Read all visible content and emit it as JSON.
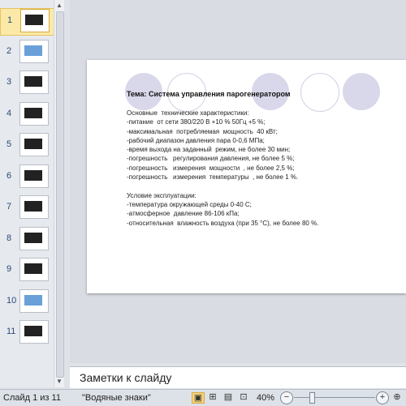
{
  "slides_panel": {
    "thumbnails": [
      {
        "num": "1"
      },
      {
        "num": "2"
      },
      {
        "num": "3"
      },
      {
        "num": "4"
      },
      {
        "num": "5"
      },
      {
        "num": "6"
      },
      {
        "num": "7"
      },
      {
        "num": "8"
      },
      {
        "num": "9"
      },
      {
        "num": "10"
      },
      {
        "num": "11"
      }
    ],
    "active_index": 0
  },
  "slide": {
    "title": "Тема:  Система  управления  парогенератором",
    "body": "Основные  технические характеристики:\n-питание  от сети 380/220 В +10 % 50Гц +5 %;\n-максимальная  потребляемая  мощность  40 кВт;\n-рабочий диапазон давления пара 0-0,6 МПа;\n-время выхода на заданный  режим, не более 30 мин;\n-погрешность   регулирования давления, не более 5 %;\n-погрешность   измерения  мощности  , не более 2,5 %;\n-погрешность   измерения  температуры  , не более 1 %.\n\nУсловие эксплуатации:\n-температура окружающей среды 0-40 С;\n-атмосферное  давление 86-106 кПа;\n-относительная  влажность воздуха (при 35 °С), не более 80 %."
  },
  "notes": {
    "placeholder": "Заметки к слайду"
  },
  "status": {
    "slide_counter": "Слайд 1 из 11",
    "theme": "\"Водяные знаки\"",
    "zoom": "40%",
    "zoom_minus": "−",
    "zoom_plus": "+"
  },
  "colors": {
    "accent_circle": "#d9d7ea",
    "active_thumb": "#fbe9a8"
  }
}
